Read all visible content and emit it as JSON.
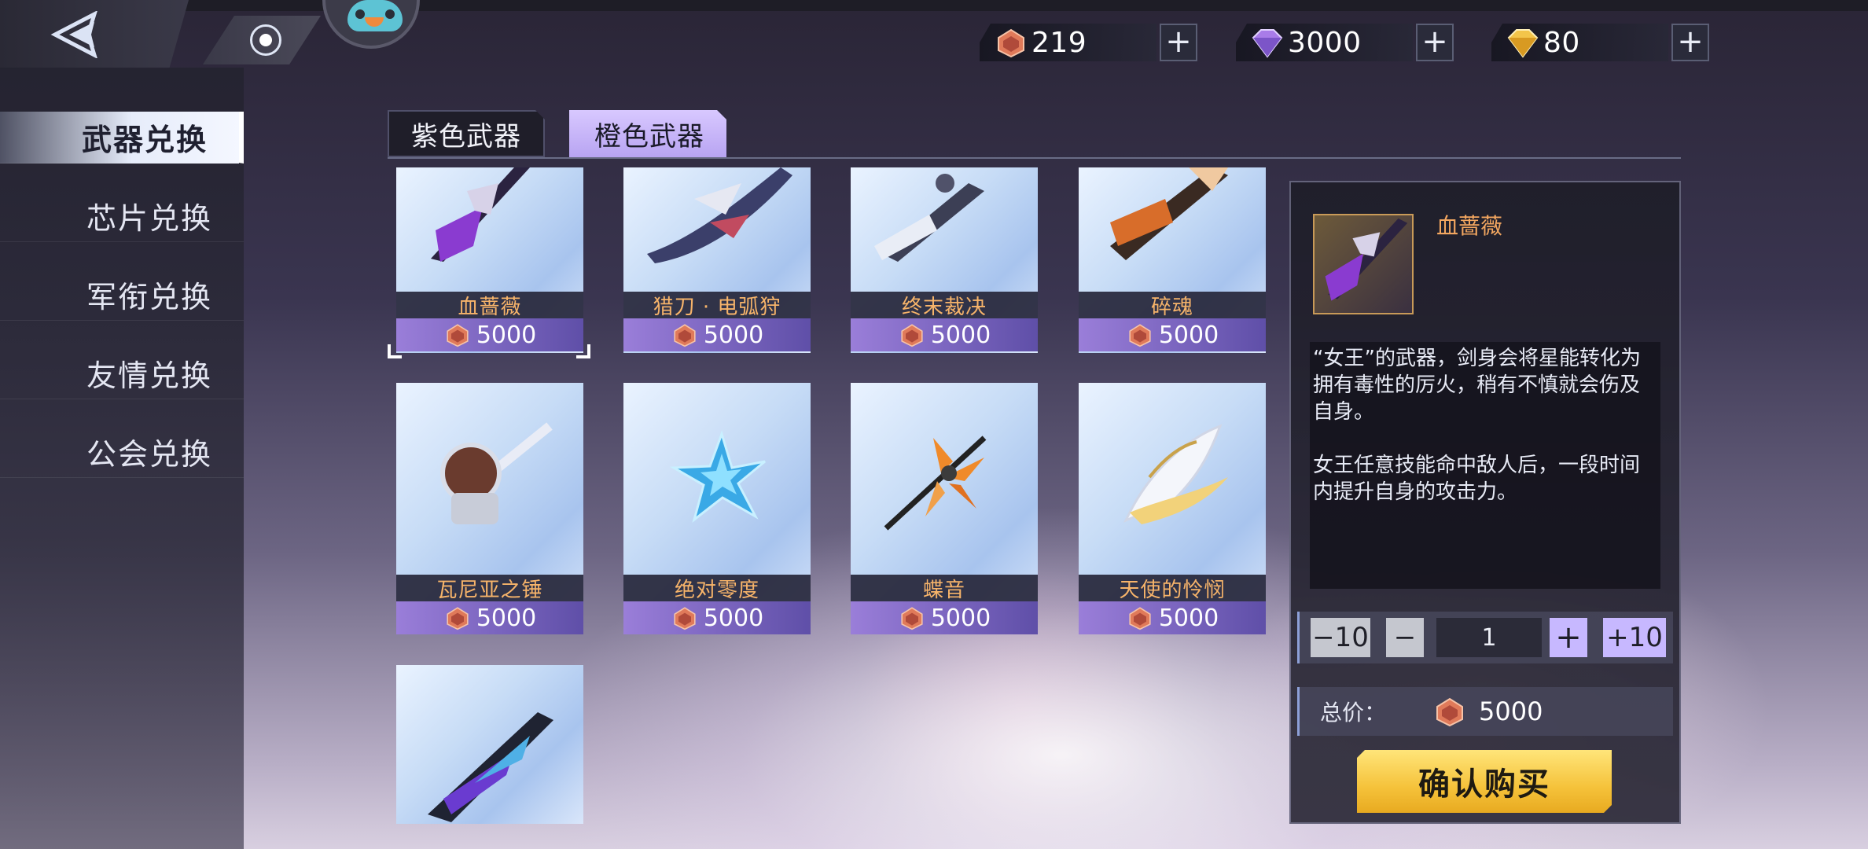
{
  "header": {
    "currencies": [
      {
        "icon": "ticket-icon",
        "value": "219"
      },
      {
        "icon": "purple-gem-icon",
        "value": "3000"
      },
      {
        "icon": "gold-gem-icon",
        "value": "80"
      }
    ],
    "plus_label": "+"
  },
  "sidebar": {
    "items": [
      {
        "label": "武器兑换",
        "active": true
      },
      {
        "label": "芯片兑换",
        "active": false
      },
      {
        "label": "军衔兑换",
        "active": false
      },
      {
        "label": "友情兑换",
        "active": false
      },
      {
        "label": "公会兑换",
        "active": false
      }
    ]
  },
  "tabs": [
    {
      "label": "紫色武器",
      "active": false
    },
    {
      "label": "橙色武器",
      "active": true
    }
  ],
  "items": [
    {
      "name": "血蔷薇",
      "price": "5000",
      "selected": true
    },
    {
      "name": "猎刀 · 电弧狩",
      "price": "5000"
    },
    {
      "name": "终末裁决",
      "price": "5000"
    },
    {
      "name": "碎魂",
      "price": "5000"
    },
    {
      "name": "瓦尼亚之锤",
      "price": "5000"
    },
    {
      "name": "绝对零度",
      "price": "5000"
    },
    {
      "name": "蝶音",
      "price": "5000"
    },
    {
      "name": "天使的怜悯",
      "price": "5000"
    },
    {
      "name": "",
      "price": ""
    }
  ],
  "detail": {
    "title": "血蔷薇",
    "description": "“女王”的武器，剑身会将星能转化为拥有毒性的厉火，稍有不慎就会伤及自身。\n\n女王任意技能命中敌人后，一段时间内提升自身的攻击力。",
    "qty_minus10": "−10",
    "qty_minus1": "−",
    "quantity": "1",
    "qty_plus1": "+",
    "qty_plus10": "+10",
    "total_label": "总价：",
    "total_value": "5000",
    "confirm_label": "确认购买"
  },
  "colors": {
    "accent_orange": "#f3a760",
    "price_bar": "#7d67c2",
    "confirm": "#f5c23a"
  }
}
